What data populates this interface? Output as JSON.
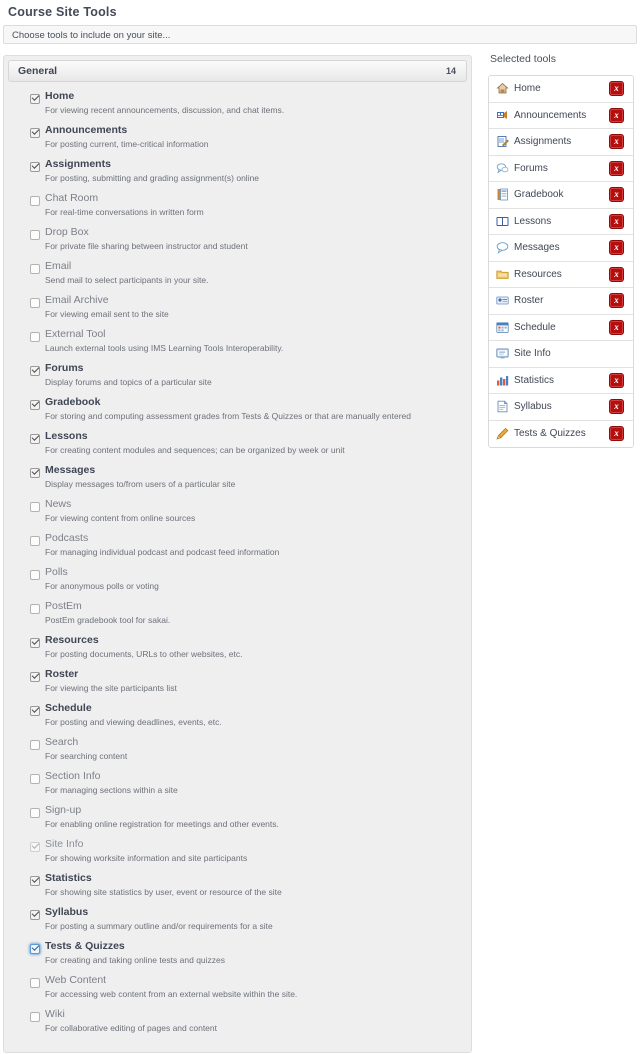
{
  "header": {
    "title": "Course Site Tools",
    "instruction": "Choose tools to include on your site..."
  },
  "tools_panel": {
    "section_title": "General",
    "section_count": "14",
    "items": [
      {
        "label": "Home",
        "desc": "For viewing recent announcements, discussion, and chat items.",
        "checked": true,
        "disabled": false,
        "focused": false
      },
      {
        "label": "Announcements",
        "desc": "For posting current, time-critical information",
        "checked": true,
        "disabled": false,
        "focused": false
      },
      {
        "label": "Assignments",
        "desc": "For posting, submitting and grading assignment(s) online",
        "checked": true,
        "disabled": false,
        "focused": false
      },
      {
        "label": "Chat Room",
        "desc": "For real-time conversations in written form",
        "checked": false,
        "disabled": false,
        "focused": false
      },
      {
        "label": "Drop Box",
        "desc": "For private file sharing between instructor and student",
        "checked": false,
        "disabled": false,
        "focused": false
      },
      {
        "label": "Email",
        "desc": "Send mail to select participants in your site.",
        "checked": false,
        "disabled": false,
        "focused": false
      },
      {
        "label": "Email Archive",
        "desc": "For viewing email sent to the site",
        "checked": false,
        "disabled": false,
        "focused": false
      },
      {
        "label": "External Tool",
        "desc": "Launch external tools using IMS Learning Tools Interoperability.",
        "checked": false,
        "disabled": false,
        "focused": false
      },
      {
        "label": "Forums",
        "desc": "Display forums and topics of a particular site",
        "checked": true,
        "disabled": false,
        "focused": false
      },
      {
        "label": "Gradebook",
        "desc": "For storing and computing assessment grades from Tests & Quizzes or that are manually entered",
        "checked": true,
        "disabled": false,
        "focused": false
      },
      {
        "label": "Lessons",
        "desc": "For creating content modules and sequences; can be organized by week or unit",
        "checked": true,
        "disabled": false,
        "focused": false
      },
      {
        "label": "Messages",
        "desc": "Display messages to/from users of a particular site",
        "checked": true,
        "disabled": false,
        "focused": false
      },
      {
        "label": "News",
        "desc": "For viewing content from online sources",
        "checked": false,
        "disabled": false,
        "focused": false
      },
      {
        "label": "Podcasts",
        "desc": "For managing individual podcast and podcast feed information",
        "checked": false,
        "disabled": false,
        "focused": false
      },
      {
        "label": "Polls",
        "desc": "For anonymous polls or voting",
        "checked": false,
        "disabled": false,
        "focused": false
      },
      {
        "label": "PostEm",
        "desc": "PostEm gradebook tool for sakai.",
        "checked": false,
        "disabled": false,
        "focused": false
      },
      {
        "label": "Resources",
        "desc": "For posting documents, URLs to other websites, etc.",
        "checked": true,
        "disabled": false,
        "focused": false
      },
      {
        "label": "Roster",
        "desc": "For viewing the site participants list",
        "checked": true,
        "disabled": false,
        "focused": false
      },
      {
        "label": "Schedule",
        "desc": "For posting and viewing deadlines, events, etc.",
        "checked": true,
        "disabled": false,
        "focused": false
      },
      {
        "label": "Search",
        "desc": "For searching content",
        "checked": false,
        "disabled": false,
        "focused": false
      },
      {
        "label": "Section Info",
        "desc": "For managing sections within a site",
        "checked": false,
        "disabled": false,
        "focused": false
      },
      {
        "label": "Sign-up",
        "desc": "For enabling online registration for meetings and other events.",
        "checked": false,
        "disabled": false,
        "focused": false
      },
      {
        "label": "Site Info",
        "desc": "For showing worksite information and site participants",
        "checked": true,
        "disabled": true,
        "focused": false
      },
      {
        "label": "Statistics",
        "desc": "For showing site statistics by user, event or resource of the site",
        "checked": true,
        "disabled": false,
        "focused": false
      },
      {
        "label": "Syllabus",
        "desc": "For posting a summary outline and/or requirements for a site",
        "checked": true,
        "disabled": false,
        "focused": false
      },
      {
        "label": "Tests & Quizzes",
        "desc": "For creating and taking online tests and quizzes",
        "checked": true,
        "disabled": false,
        "focused": true
      },
      {
        "label": "Web Content",
        "desc": "For accessing web content from an external website within the site.",
        "checked": false,
        "disabled": false,
        "focused": false
      },
      {
        "label": "Wiki",
        "desc": "For collaborative editing of pages and content",
        "checked": false,
        "disabled": false,
        "focused": false
      }
    ]
  },
  "selected_panel": {
    "heading": "Selected tools",
    "remove_label": "x",
    "items": [
      {
        "label": "Home",
        "icon": "house-icon",
        "removable": true
      },
      {
        "label": "Announcements",
        "icon": "megaphone-icon",
        "removable": true
      },
      {
        "label": "Assignments",
        "icon": "pencil-page-icon",
        "removable": true
      },
      {
        "label": "Forums",
        "icon": "speech-bubbles-icon",
        "removable": true
      },
      {
        "label": "Gradebook",
        "icon": "book-grades-icon",
        "removable": true
      },
      {
        "label": "Lessons",
        "icon": "open-book-icon",
        "removable": true
      },
      {
        "label": "Messages",
        "icon": "speech-bubble-icon",
        "removable": true
      },
      {
        "label": "Resources",
        "icon": "folder-icon",
        "removable": true
      },
      {
        "label": "Roster",
        "icon": "id-card-icon",
        "removable": true
      },
      {
        "label": "Schedule",
        "icon": "calendar-icon",
        "removable": true
      },
      {
        "label": "Site Info",
        "icon": "info-screen-icon",
        "removable": false
      },
      {
        "label": "Statistics",
        "icon": "bar-chart-icon",
        "removable": true
      },
      {
        "label": "Syllabus",
        "icon": "document-icon",
        "removable": true
      },
      {
        "label": "Tests & Quizzes",
        "icon": "pencil-icon",
        "removable": true
      }
    ]
  },
  "colors": {
    "remove_button": "#b40f0f",
    "panel_bg": "#efefef",
    "label_checked": "#3f4654",
    "label_unchecked": "#7b7f88"
  }
}
